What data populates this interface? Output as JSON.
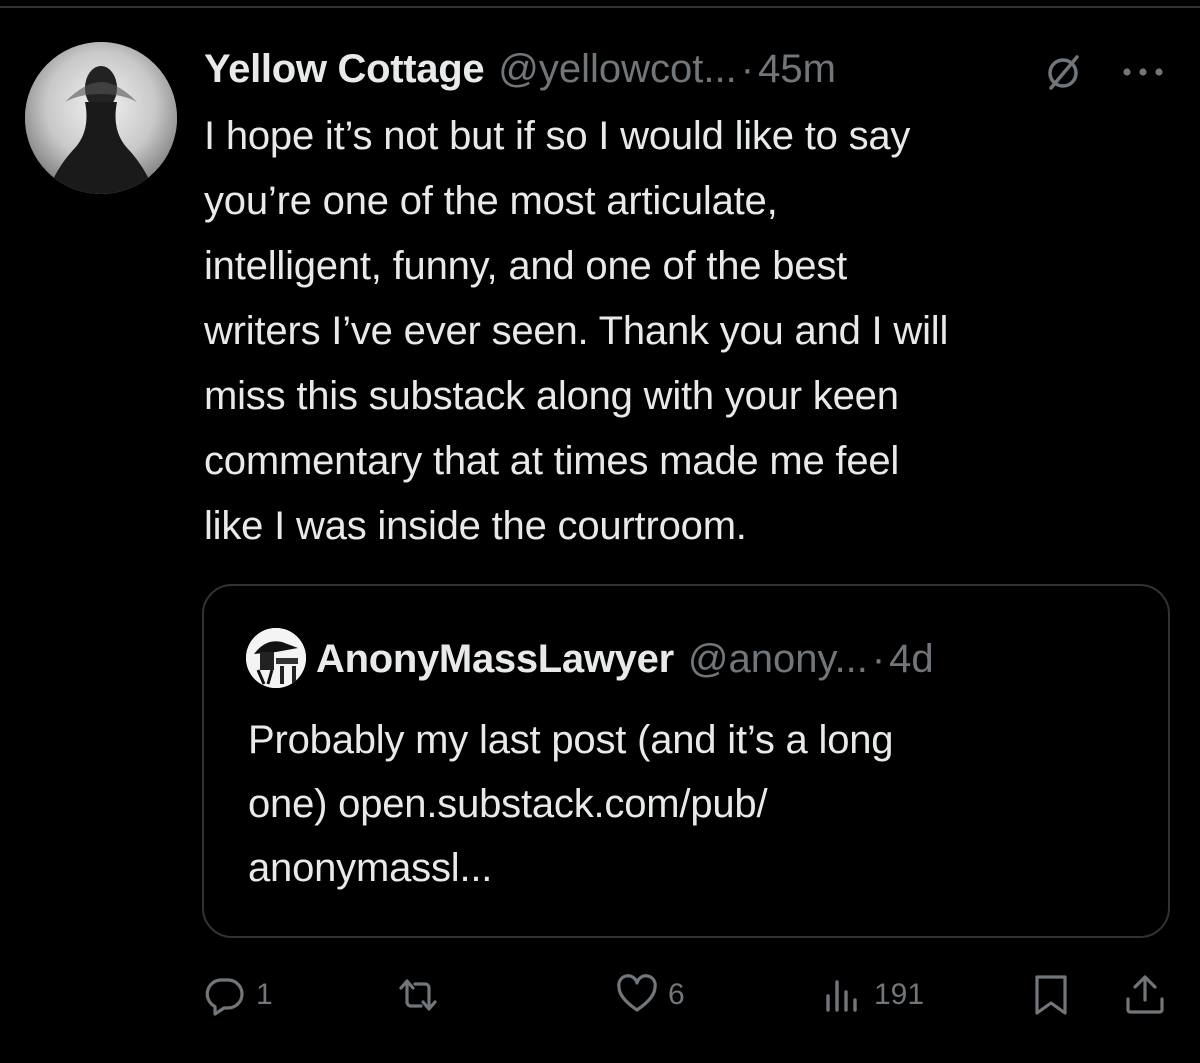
{
  "tweet": {
    "author_name": "Yellow Cottage",
    "author_handle": "@yellowcot...",
    "separator": "·",
    "time": "45m",
    "text": "I hope it’s not but if so I would like to say\nyou’re one of the most articulate,\nintelligent, funny, and one of the best\nwriters I’ve ever seen. Thank you and I will\nmiss this substack along with your keen\ncommentary that at times made me feel\nlike I was inside the courtroom."
  },
  "quote": {
    "author_name": "AnonyMassLawyer",
    "author_handle": "@anony...",
    "separator": "·",
    "time": "4d",
    "text": "Probably my last post (and it’s a long\none) open.substack.com/pub/\nanonymassl..."
  },
  "actions": {
    "replies": "1",
    "retweets": "",
    "likes": "6",
    "views": "191"
  },
  "icons": {
    "reply": "reply-icon",
    "retweet": "retweet-icon",
    "like": "heart-icon",
    "views": "views-icon",
    "bookmark": "bookmark-icon",
    "share": "share-icon",
    "grok": "grok-icon",
    "more": "more-icon"
  },
  "colors": {
    "background": "#000000",
    "primary_text": "#e7e9ea",
    "secondary_text": "#71767b",
    "border": "#2f3336"
  }
}
